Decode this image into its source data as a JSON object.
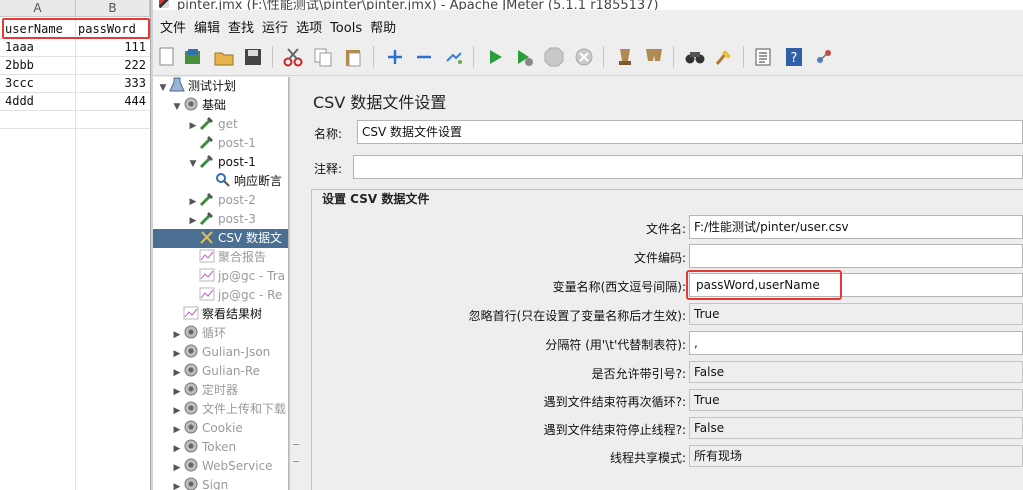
{
  "sheet": {
    "columns": [
      "A",
      "B"
    ],
    "rows": [
      [
        "userName",
        "passWord"
      ],
      [
        "1aaa",
        "111"
      ],
      [
        "2bbb",
        "222"
      ],
      [
        "3ccc",
        "333"
      ],
      [
        "4ddd",
        "444"
      ]
    ]
  },
  "window": {
    "title": "pinter.jmx (F:\\性能测试\\pinter\\pinter.jmx) - Apache JMeter (5.1.1 r1855137)"
  },
  "menu": {
    "items": [
      "文件",
      "编辑",
      "查找",
      "运行",
      "选项",
      "Tools",
      "帮助"
    ]
  },
  "toolbar": {
    "icons": [
      "new-icon",
      "templates-icon",
      "open-icon",
      "save-icon",
      "cut-icon",
      "copy-icon",
      "paste-icon",
      "expand-icon",
      "collapse-icon",
      "toggle-icon",
      "start-icon",
      "start-no-pause-icon",
      "stop-icon",
      "shutdown-icon",
      "clear-icon",
      "clear-all-icon",
      "search-icon",
      "reset-search-icon",
      "function-helper-icon",
      "help-icon",
      "remote-icon"
    ]
  },
  "tree": {
    "nodes": [
      {
        "label": "测试计划",
        "icon": "test-plan-icon",
        "level": 0,
        "toggle": "▼"
      },
      {
        "label": "基础",
        "icon": "thread-group-icon",
        "level": 1,
        "toggle": "▼"
      },
      {
        "label": "get",
        "icon": "sampler-icon",
        "level": 2,
        "toggle": "▶",
        "dim": true
      },
      {
        "label": "post-1",
        "icon": "sampler-icon",
        "level": 2,
        "toggle": "",
        "dim": true
      },
      {
        "label": "post-1",
        "icon": "sampler-icon",
        "level": 2,
        "toggle": "▼"
      },
      {
        "label": "响应断言",
        "icon": "assertion-icon",
        "level": 3,
        "toggle": ""
      },
      {
        "label": "post-2",
        "icon": "sampler-icon",
        "level": 2,
        "toggle": "▶",
        "dim": true
      },
      {
        "label": "post-3",
        "icon": "sampler-icon",
        "level": 2,
        "toggle": "▶",
        "dim": true
      },
      {
        "label": "CSV 数据文",
        "icon": "config-icon",
        "level": 2,
        "toggle": "",
        "selected": true
      },
      {
        "label": "聚合报告",
        "icon": "listener-icon",
        "level": 2,
        "toggle": "",
        "dim": true
      },
      {
        "label": "jp@gc - Tra",
        "icon": "listener-icon",
        "level": 2,
        "toggle": "",
        "dim": true
      },
      {
        "label": "jp@gc - Re",
        "icon": "listener-icon",
        "level": 2,
        "toggle": "",
        "dim": true
      },
      {
        "label": "察看结果树",
        "icon": "listener-icon",
        "level": 1,
        "toggle": ""
      },
      {
        "label": "循环",
        "icon": "thread-group-icon",
        "level": 1,
        "toggle": "▶",
        "dim": true
      },
      {
        "label": "Gulian-Json",
        "icon": "thread-group-icon",
        "level": 1,
        "toggle": "▶",
        "dim": true
      },
      {
        "label": "Gulian-Re",
        "icon": "thread-group-icon",
        "level": 1,
        "toggle": "▶",
        "dim": true
      },
      {
        "label": "定时器",
        "icon": "thread-group-icon",
        "level": 1,
        "toggle": "▶",
        "dim": true
      },
      {
        "label": "文件上传和下载",
        "icon": "thread-group-icon",
        "level": 1,
        "toggle": "▶",
        "dim": true
      },
      {
        "label": "Cookie",
        "icon": "thread-group-icon",
        "level": 1,
        "toggle": "▶",
        "dim": true
      },
      {
        "label": "Token",
        "icon": "thread-group-icon",
        "level": 1,
        "toggle": "▶",
        "dim": true
      },
      {
        "label": "WebService",
        "icon": "thread-group-icon",
        "level": 1,
        "toggle": "▶",
        "dim": true
      },
      {
        "label": "Sign",
        "icon": "thread-group-icon",
        "level": 1,
        "toggle": "▶",
        "dim": true
      }
    ]
  },
  "panel": {
    "title": "CSV 数据文件设置",
    "name_label": "名称:",
    "name_value": "CSV 数据文件设置",
    "comment_label": "注释:",
    "comment_value": "",
    "group_title": "设置 CSV 数据文件",
    "fields": {
      "filename_label": "文件名:",
      "filename_value": "F:/性能测试/pinter/user.csv",
      "encoding_label": "文件编码:",
      "encoding_value": "",
      "varnames_label": "变量名称(西文逗号间隔):",
      "varnames_value": "passWord,userName",
      "ignore_first_label": "忽略首行(只在设置了变量名称后才生效):",
      "ignore_first_value": "True",
      "delimiter_label": "分隔符 (用'\\t'代替制表符):",
      "delimiter_value": ",",
      "quoted_label": "是否允许带引号?:",
      "quoted_value": "False",
      "recycle_label": "遇到文件结束符再次循环?:",
      "recycle_value": "True",
      "stop_label": "遇到文件结束符停止线程?:",
      "stop_value": "False",
      "share_label": "线程共享模式:",
      "share_value": "所有现场"
    }
  }
}
